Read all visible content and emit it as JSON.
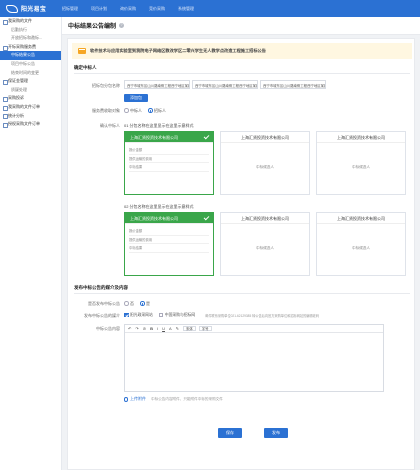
{
  "topbar": {
    "logo": "阳光易宝",
    "nav": [
      "招标管理",
      "项目计划",
      "询价采购",
      "竞价采购",
      "系统管理"
    ]
  },
  "sidebar": {
    "items": [
      {
        "label": "我采购的文件",
        "type": "sec"
      },
      {
        "label": "后勤执行",
        "type": "sub"
      },
      {
        "label": "开放招标和邀标...",
        "type": "sub"
      },
      {
        "label": "开标采购服务费",
        "type": "sec"
      },
      {
        "label": "中标结果公告",
        "type": "sub",
        "active": true
      },
      {
        "label": "项目中标公告",
        "type": "sub"
      },
      {
        "label": "结束时间的变更",
        "type": "sub"
      },
      {
        "label": "保证金管理",
        "type": "sec"
      },
      {
        "label": "质疑处理",
        "type": "sub"
      },
      {
        "label": "采购投诉",
        "type": "sec"
      },
      {
        "label": "我采购的文件订单",
        "type": "sec"
      },
      {
        "label": "统计分析",
        "type": "sec"
      },
      {
        "label": "授权采购文件订单",
        "type": "sec"
      }
    ]
  },
  "page": {
    "title": "中标结果公告编制",
    "help": "?"
  },
  "banner": {
    "text": "软件技术与应用实验室到我院电子网络区教改学区二零兴学生无人教学点改造工程施工招标公告"
  },
  "section1": {
    "title": "确定中标人",
    "packages_label": "招标包分包名称",
    "packages": [
      "西宁市城东区山川路南侧工程西宁地区某路上设某乙...",
      "西宁市城东区山川路南侧工程西宁地区某路上设某乙...",
      "西宁市城东区山川路南侧工程西宁地区某路上设某乙..."
    ],
    "add_button": "添加包",
    "service_fee_label": "服务费收取对象",
    "service_fee_options": [
      {
        "label": "中标人",
        "selected": false
      },
      {
        "label": "招标人",
        "selected": true
      }
    ],
    "winner_label": "确认中标人",
    "pkg1_title": "01 分包名称在这里显示在这里示意样式",
    "pkg2_title": "02 分包名称在这里显示在这里示意样式",
    "suppliers_pkg1": [
      {
        "name": "上海汇贤投资技术有限公司",
        "selected": true,
        "lines": [
          "报价金额",
          "提供运输的费用",
          "中标结果"
        ],
        "status": ""
      },
      {
        "name": "上海汇贤投资技术有限公司",
        "selected": false,
        "lines": [],
        "status": "中标候选人"
      },
      {
        "name": "上海汇贤投资技术有限公司",
        "selected": false,
        "lines": [],
        "status": "中标候选人"
      }
    ],
    "suppliers_pkg2": [
      {
        "name": "上海汇贤投资技术有限公司",
        "selected": true,
        "lines": [
          "报价金额",
          "提供运输的费用",
          "中标结果"
        ],
        "status": ""
      },
      {
        "name": "上海汇贤投资技术有限公司",
        "selected": false,
        "lines": [],
        "status": "中标候选人"
      },
      {
        "name": "上海汇贤投资技术有限公司",
        "selected": false,
        "lines": [],
        "status": "中标候选人"
      }
    ]
  },
  "section2": {
    "title": "发布中标公告的媒介及内容",
    "publish_label": "是否发布中标公告",
    "publish_options": [
      {
        "label": "否",
        "selected": false
      },
      {
        "label": "是",
        "selected": true
      }
    ],
    "media_label": "发布中标公告的媒介",
    "media_options": [
      {
        "label": "阳光政采网站",
        "checked": true
      },
      {
        "label": "中国采购与招标网",
        "checked": false
      }
    ],
    "media_note": "邮件联系采购单位021-62129385 转公告后向官方采购单位和招标网站的编辑老码",
    "content_label": "中标公告内容",
    "toolbar": [
      "↶",
      "↷",
      "⊘",
      "B",
      "I",
      "U",
      "A",
      "✎"
    ],
    "font_select": "宋体",
    "size_select": "字号",
    "upload_label": "上传附件",
    "upload_note": "中标公告内容附件，只能附件中标的采购文件",
    "save_button": "保存",
    "publish_button": "发布"
  }
}
